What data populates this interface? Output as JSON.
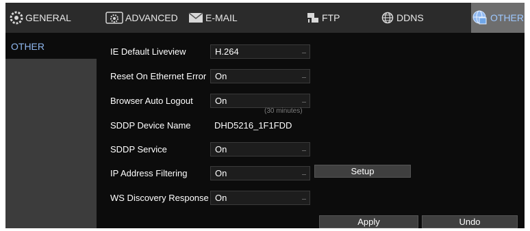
{
  "tabs": [
    {
      "label": "GENERAL",
      "icon": "gear-icon"
    },
    {
      "label": "ADVANCED",
      "icon": "advanced-settings-icon"
    },
    {
      "label": "E-MAIL",
      "icon": "envelope-icon"
    },
    {
      "label": "FTP",
      "icon": "ftp-icon"
    },
    {
      "label": "DDNS",
      "icon": "globe-icon"
    },
    {
      "label": "OTHER",
      "icon": "other-settings-icon"
    }
  ],
  "active_tab": "OTHER",
  "sidebar": {
    "items": [
      {
        "label": "OTHER"
      }
    ]
  },
  "form": {
    "ie_default_liveview": {
      "label": "IE Default Liveview",
      "value": "H.264"
    },
    "reset_on_ethernet_error": {
      "label": "Reset On Ethernet Error",
      "value": "On"
    },
    "browser_auto_logout": {
      "label": "Browser Auto Logout",
      "value": "On",
      "hint": "(30 minutes)"
    },
    "sddp_device_name": {
      "label": "SDDP Device Name",
      "value": "DHD5216_1F1FDD"
    },
    "sddp_service": {
      "label": "SDDP Service",
      "value": "On"
    },
    "ip_address_filtering": {
      "label": "IP Address Filtering",
      "value": "On",
      "setup_label": "Setup"
    },
    "ws_discovery_response": {
      "label": "WS Discovery Response",
      "value": "On"
    }
  },
  "actions": {
    "apply_label": "Apply",
    "undo_label": "Undo"
  },
  "colors": {
    "background": "#0c0c0c",
    "tabbar": "#2b2b2b",
    "active_tab": "#6e6e6e",
    "accent_text": "#8fb8f0",
    "sidebar": "#3c3c3c"
  }
}
